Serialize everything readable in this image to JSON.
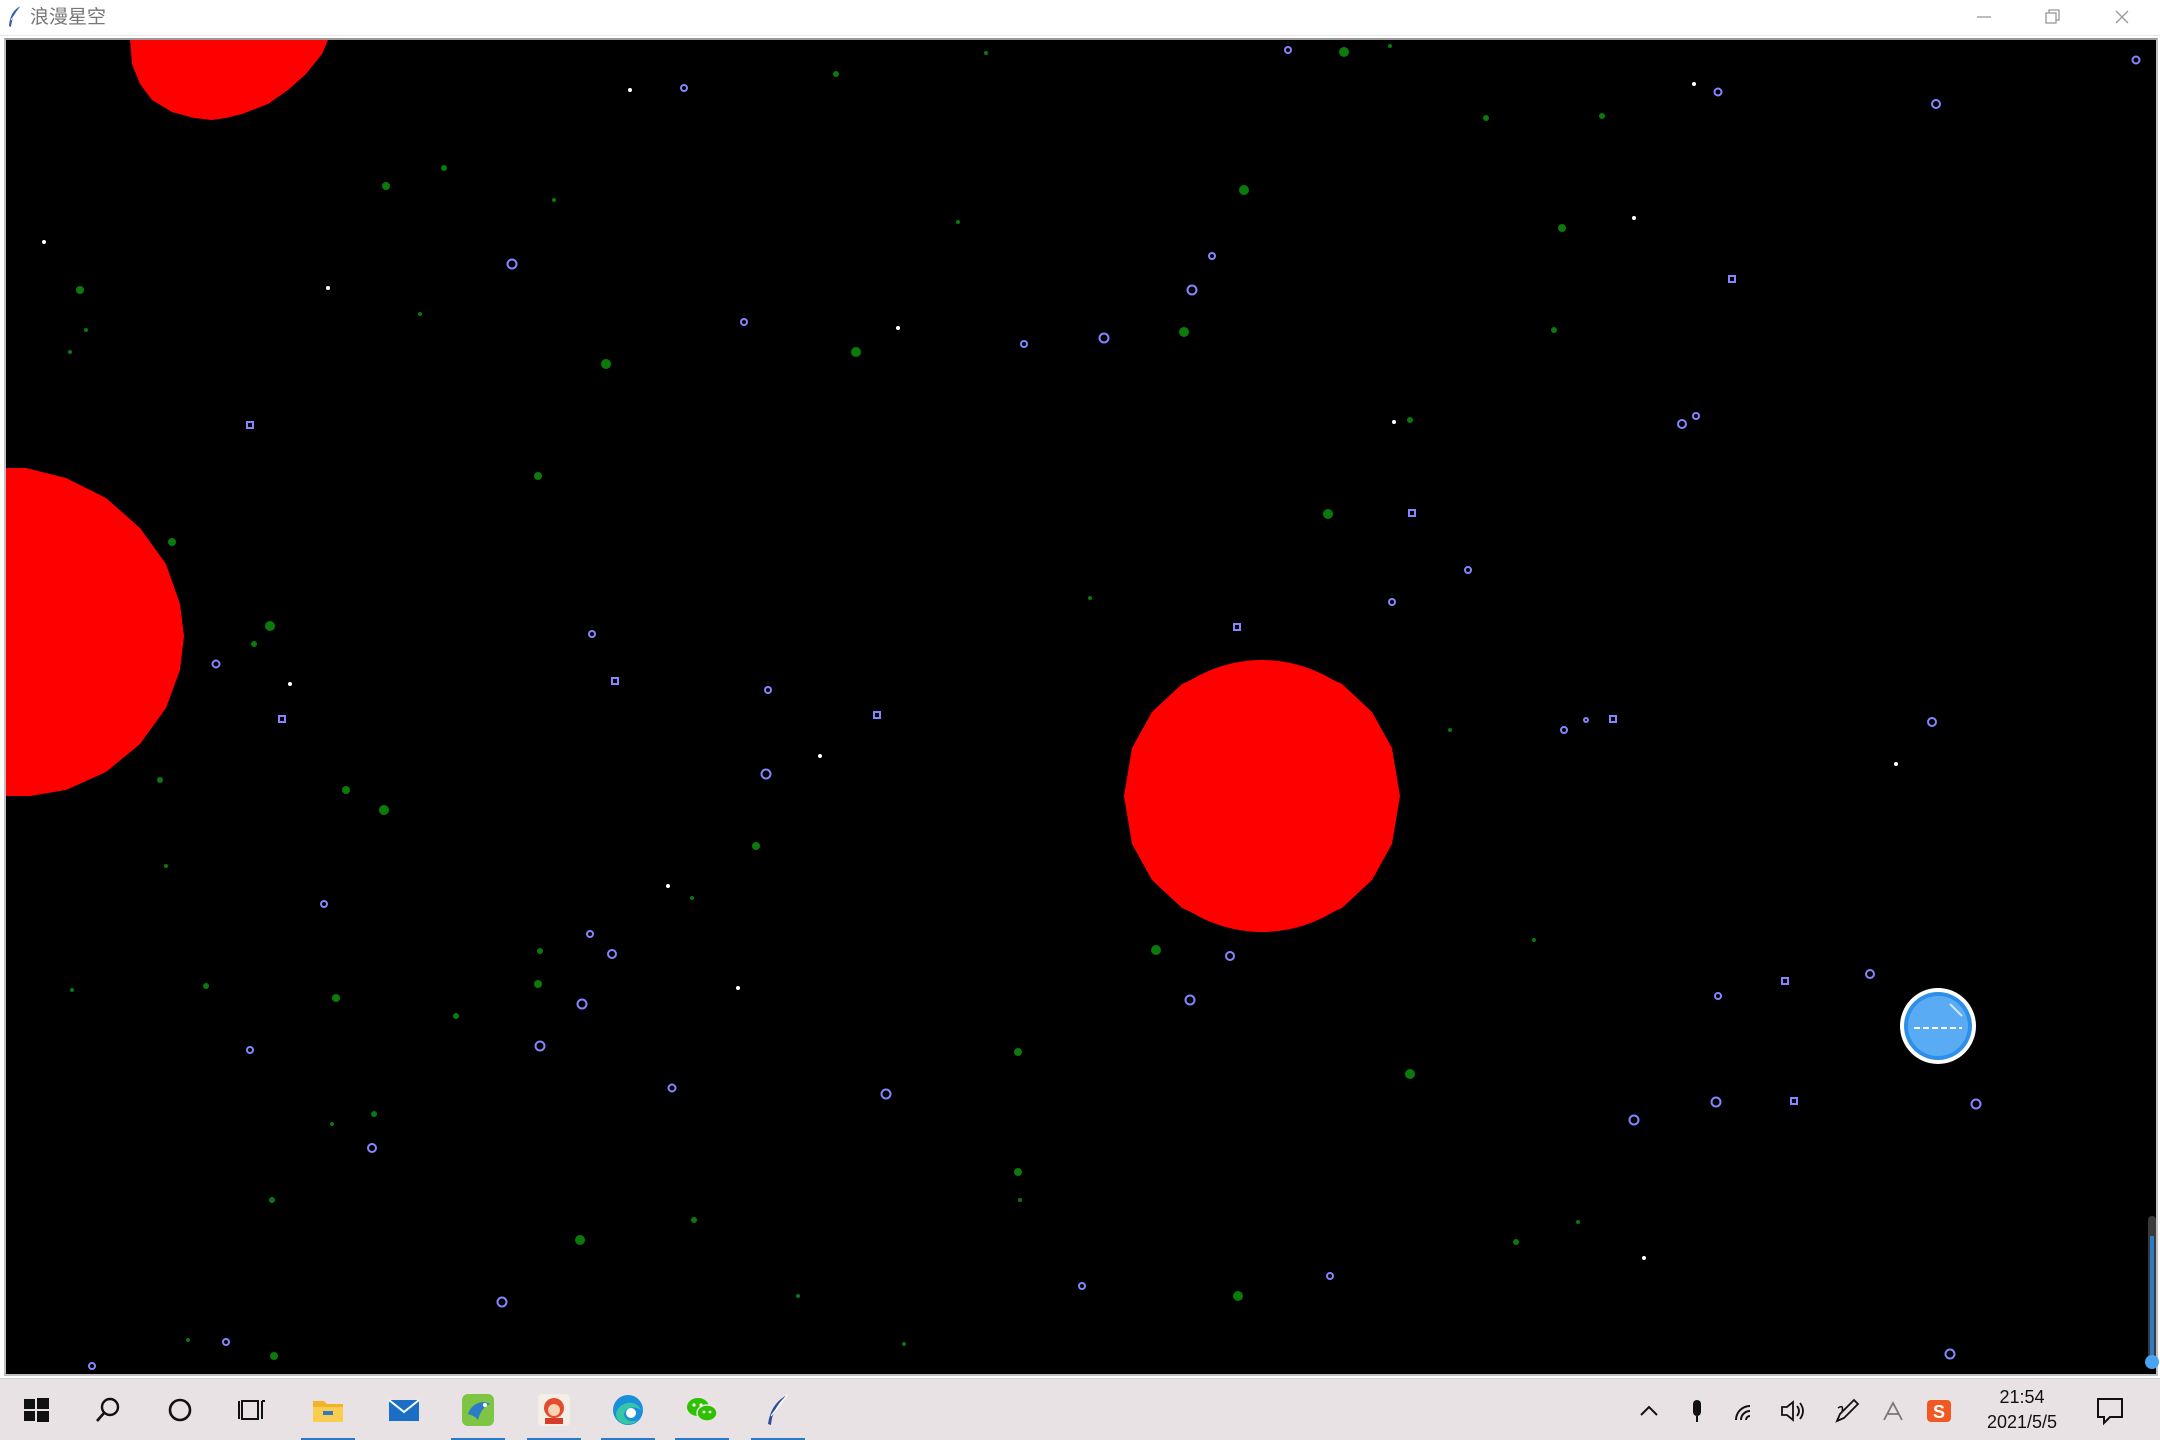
{
  "window": {
    "title": "浪漫星空",
    "icon": "feather-icon",
    "controls": [
      "minimize-icon",
      "maximize-icon",
      "close-icon"
    ]
  },
  "canvas": {
    "background": "#000000",
    "planet_color": "#ff0000",
    "star_color": "#8080ff",
    "dust_color": "#0a7a0a"
  },
  "floating_button": {
    "icon": "assistive-ball-icon",
    "color": "#4aa3f0"
  },
  "taskbar": {
    "apps": [
      {
        "name": "start",
        "icon": "windows-start-icon"
      },
      {
        "name": "search",
        "icon": "search-icon"
      },
      {
        "name": "cortana",
        "icon": "cortana-circle-icon"
      },
      {
        "name": "task-view",
        "icon": "task-view-icon"
      },
      {
        "name": "file-explorer",
        "icon": "folder-icon",
        "running": true
      },
      {
        "name": "mail",
        "icon": "mail-icon",
        "running": false
      },
      {
        "name": "bird-app",
        "icon": "bird-app-icon",
        "running": true
      },
      {
        "name": "game-app",
        "icon": "game-character-icon",
        "running": true
      },
      {
        "name": "edge",
        "icon": "edge-browser-icon",
        "running": true
      },
      {
        "name": "wechat",
        "icon": "wechat-icon",
        "running": true
      },
      {
        "name": "python-tk",
        "icon": "feather-icon",
        "running": true
      }
    ],
    "tray": [
      "chevron-up-icon",
      "microphone-icon",
      "wifi-icon",
      "volume-icon",
      "pen-icon",
      "ime-icon",
      "sogou-icon"
    ],
    "time": "21:54",
    "date": "2021/5/5",
    "notification_icon": "notification-icon",
    "accent": "#2d7ac7"
  }
}
